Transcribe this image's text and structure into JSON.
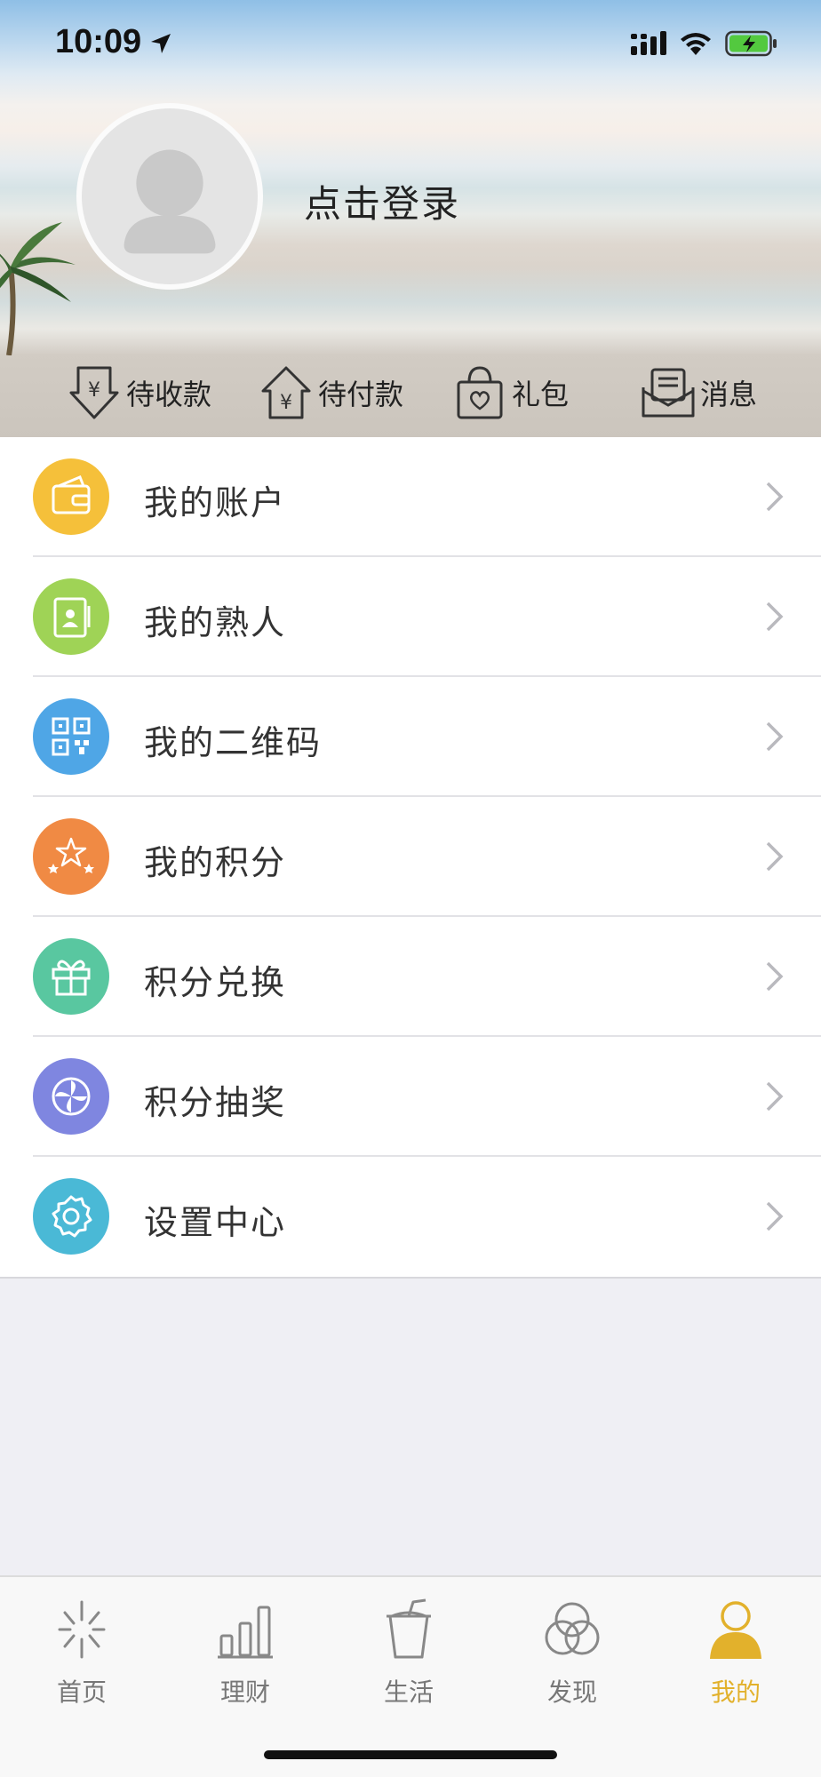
{
  "status_bar": {
    "time": "10:09"
  },
  "profile": {
    "login_text": "点击登录"
  },
  "quick_actions": [
    {
      "label": "待收款",
      "icon": "receive-money-icon"
    },
    {
      "label": "待付款",
      "icon": "pay-money-icon"
    },
    {
      "label": "礼包",
      "icon": "gift-bag-icon"
    },
    {
      "label": "消息",
      "icon": "message-icon"
    }
  ],
  "menu": [
    {
      "label": "我的账户",
      "icon": "wallet-icon",
      "color": "#f5c03a"
    },
    {
      "label": "我的熟人",
      "icon": "contacts-icon",
      "color": "#9fd356"
    },
    {
      "label": "我的二维码",
      "icon": "qrcode-icon",
      "color": "#4fa6e6"
    },
    {
      "label": "我的积分",
      "icon": "stars-icon",
      "color": "#f08a44"
    },
    {
      "label": "积分兑换",
      "icon": "gift-icon",
      "color": "#59c7a0"
    },
    {
      "label": "积分抽奖",
      "icon": "pinwheel-icon",
      "color": "#7f86e0"
    },
    {
      "label": "设置中心",
      "icon": "gear-icon",
      "color": "#4ab9d6"
    }
  ],
  "tabbar": {
    "active_color": "#e2b12c",
    "items": [
      {
        "label": "首页",
        "icon": "home-burst-icon"
      },
      {
        "label": "理财",
        "icon": "bar-chart-icon"
      },
      {
        "label": "生活",
        "icon": "drink-cup-icon"
      },
      {
        "label": "发现",
        "icon": "discover-icon"
      },
      {
        "label": "我的",
        "icon": "person-icon",
        "active": true
      }
    ]
  }
}
